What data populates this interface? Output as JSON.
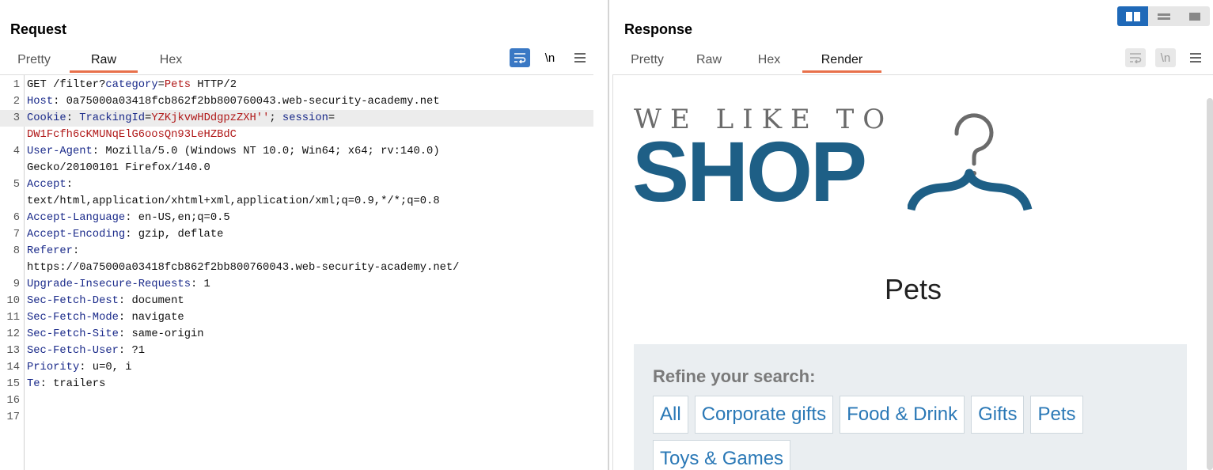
{
  "request": {
    "title": "Request",
    "tabs": [
      {
        "label": "Pretty",
        "active": false
      },
      {
        "label": "Raw",
        "active": true
      },
      {
        "label": "Hex",
        "active": false
      }
    ],
    "toolbar": {
      "wrap_icon": "wrap-lines-icon",
      "newline_label": "\\n",
      "menu_icon": "hamburger-menu-icon"
    },
    "lines": [
      {
        "n": "1",
        "segs": [
          [
            "t",
            "GET /filter?"
          ],
          [
            "k",
            "category"
          ],
          [
            "t",
            "="
          ],
          [
            "v",
            "Pets"
          ],
          [
            "t",
            " HTTP/2"
          ]
        ]
      },
      {
        "n": "2",
        "segs": [
          [
            "k",
            "Host"
          ],
          [
            "t",
            ": 0a75000a03418fcb862f2bb800760043.web-security-academy.net"
          ]
        ]
      },
      {
        "n": "3",
        "hl": true,
        "segs": [
          [
            "k",
            "Cookie"
          ],
          [
            "t",
            ": "
          ],
          [
            "k",
            "TrackingId"
          ],
          [
            "t",
            "="
          ],
          [
            "v",
            "YZKjkvwHDdgpzZXH''"
          ],
          [
            "t",
            "; "
          ],
          [
            "k",
            "session"
          ],
          [
            "t",
            "="
          ]
        ]
      },
      {
        "n": "",
        "segs": [
          [
            "v",
            "DW1Fcfh6cKMUNqElG6oosQn93LeHZBdC"
          ]
        ]
      },
      {
        "n": "4",
        "segs": [
          [
            "k",
            "User-Agent"
          ],
          [
            "t",
            ": Mozilla/5.0 (Windows NT 10.0; Win64; x64; rv:140.0)"
          ]
        ]
      },
      {
        "n": "",
        "segs": [
          [
            "t",
            "Gecko/20100101 Firefox/140.0"
          ]
        ]
      },
      {
        "n": "5",
        "segs": [
          [
            "k",
            "Accept"
          ],
          [
            "t",
            ":"
          ]
        ]
      },
      {
        "n": "",
        "segs": [
          [
            "t",
            "text/html,application/xhtml+xml,application/xml;q=0.9,*/*;q=0.8"
          ]
        ]
      },
      {
        "n": "6",
        "segs": [
          [
            "k",
            "Accept-Language"
          ],
          [
            "t",
            ": en-US,en;q=0.5"
          ]
        ]
      },
      {
        "n": "7",
        "segs": [
          [
            "k",
            "Accept-Encoding"
          ],
          [
            "t",
            ": gzip, deflate"
          ]
        ]
      },
      {
        "n": "8",
        "segs": [
          [
            "k",
            "Referer"
          ],
          [
            "t",
            ":"
          ]
        ]
      },
      {
        "n": "",
        "segs": [
          [
            "t",
            "https://0a75000a03418fcb862f2bb800760043.web-security-academy.net/"
          ]
        ]
      },
      {
        "n": "9",
        "segs": [
          [
            "k",
            "Upgrade-Insecure-Requests"
          ],
          [
            "t",
            ": 1"
          ]
        ]
      },
      {
        "n": "10",
        "segs": [
          [
            "k",
            "Sec-Fetch-Dest"
          ],
          [
            "t",
            ": document"
          ]
        ]
      },
      {
        "n": "11",
        "segs": [
          [
            "k",
            "Sec-Fetch-Mode"
          ],
          [
            "t",
            ": navigate"
          ]
        ]
      },
      {
        "n": "12",
        "segs": [
          [
            "k",
            "Sec-Fetch-Site"
          ],
          [
            "t",
            ": same-origin"
          ]
        ]
      },
      {
        "n": "13",
        "segs": [
          [
            "k",
            "Sec-Fetch-User"
          ],
          [
            "t",
            ": ?1"
          ]
        ]
      },
      {
        "n": "14",
        "segs": [
          [
            "k",
            "Priority"
          ],
          [
            "t",
            ": u=0, i"
          ]
        ]
      },
      {
        "n": "15",
        "segs": [
          [
            "k",
            "Te"
          ],
          [
            "t",
            ": trailers"
          ]
        ]
      },
      {
        "n": "16",
        "segs": []
      },
      {
        "n": "17",
        "segs": []
      }
    ]
  },
  "response": {
    "title": "Response",
    "tabs": [
      {
        "label": "Pretty",
        "active": false
      },
      {
        "label": "Raw",
        "active": false
      },
      {
        "label": "Hex",
        "active": false
      },
      {
        "label": "Render",
        "active": true
      }
    ],
    "toolbar": {
      "wrap_icon": "wrap-lines-icon",
      "newline_label": "\\n",
      "menu_icon": "hamburger-menu-icon"
    },
    "render": {
      "logo_top": "WE LIKE TO",
      "logo_main": "SHOP",
      "logo_icon": "clothes-hanger-icon",
      "heading": "Pets",
      "refine_title": "Refine your search:",
      "filters": [
        "All",
        "Corporate gifts",
        "Food & Drink",
        "Gifts",
        "Pets",
        "Toys & Games"
      ]
    }
  },
  "layout_toggle": {
    "icons": [
      "side-by-side-icon",
      "stacked-icon",
      "single-pane-icon"
    ],
    "active": 0
  },
  "colors": {
    "accent": "#e8704a",
    "keyword": "#1a2a8a",
    "value": "#b01818",
    "brand_blue": "#1e5f86",
    "link_blue": "#2a78b6",
    "toggle_active": "#1f69b8"
  }
}
